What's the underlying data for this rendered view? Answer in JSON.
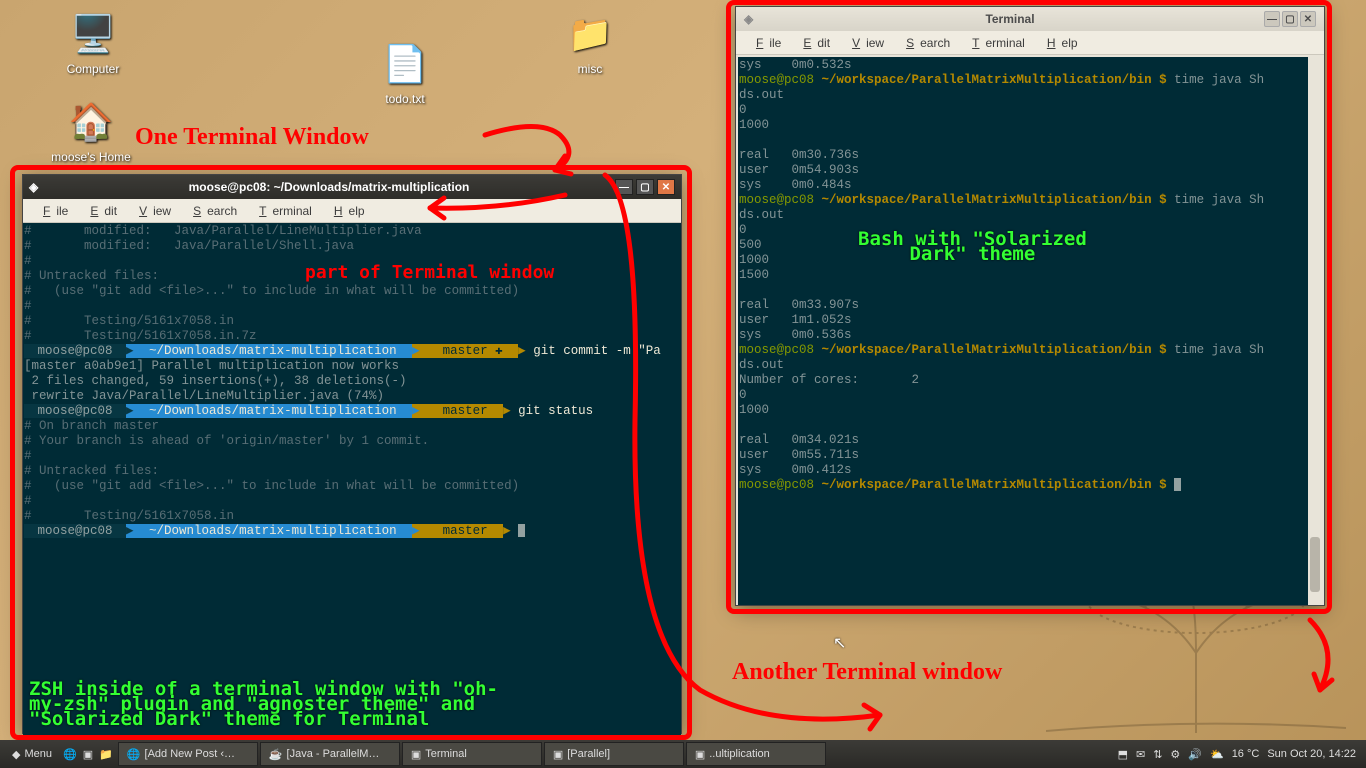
{
  "desktop": {
    "icons": [
      {
        "label": "Computer"
      },
      {
        "label": "todo.txt"
      },
      {
        "label": "misc"
      },
      {
        "label": "moose's Home"
      }
    ]
  },
  "window_left": {
    "title": "moose@pc08: ~/Downloads/matrix-multiplication",
    "menu": [
      "File",
      "Edit",
      "View",
      "Search",
      "Terminal",
      "Help"
    ],
    "lines": {
      "l1": "#       modified:   Java/Parallel/LineMultiplier.java",
      "l2": "#       modified:   Java/Parallel/Shell.java",
      "l3": "#",
      "l4": "# Untracked files:",
      "l5": "#   (use \"git add <file>...\" to include in what will be committed)",
      "l6": "#",
      "l7": "#       Testing/5161x7058.in",
      "l8": "#       Testing/5161x7058.in.7z",
      "p1_user": " moose@pc08 ",
      "p1_path": " ~/Downloads/matrix-multiplication ",
      "p1_git": "  master ✚ ",
      "p1_cmd": " git commit -m \"Pa",
      "l9": "[master a0ab9e1] Parallel multiplication now works",
      "l10": " 2 files changed, 59 insertions(+), 38 deletions(-)",
      "l11": " rewrite Java/Parallel/LineMultiplier.java (74%)",
      "p2_git": "  master ",
      "p2_cmd": " git status",
      "l12": "# On branch master",
      "l13": "# Your branch is ahead of 'origin/master' by 1 commit.",
      "l14": "#",
      "l15": "# Untracked files:",
      "l16": "#   (use \"git add <file>...\" to include in what will be committed)",
      "l17": "#",
      "l18": "#       Testing/5161x7058.in"
    }
  },
  "window_right": {
    "title": "Terminal",
    "menu": [
      "File",
      "Edit",
      "View",
      "Search",
      "Terminal",
      "Help"
    ],
    "lines": {
      "r1": "sys    0m0.532s",
      "r2a": "moose@pc08",
      "r2b": " ~/workspace/ParallelMatrixMultiplication/bin $",
      "r2c": " time java Sh",
      "r3": "ds.out",
      "r4": "0",
      "r5": "1000",
      "r7": "real   0m30.736s",
      "r8": "user   0m54.903s",
      "r9": "sys    0m0.484s",
      "r10c": " time java Sh",
      "r11": "ds.out",
      "r12": "0",
      "r13": "500",
      "r14": "1000",
      "r15": "1500",
      "r17": "real   0m33.907s",
      "r18": "user   1m1.052s",
      "r19": "sys    0m0.536s",
      "r20c": " time java Sh",
      "r21": "ds.out",
      "r22": "Number of cores:       2",
      "r23": "0",
      "r24": "1000",
      "r26": "real   0m34.021s",
      "r27": "user   0m55.711s",
      "r28": "sys    0m0.412s",
      "r29c": " "
    }
  },
  "annotations": {
    "one_window": "One Terminal Window",
    "part_of": "part of Terminal window",
    "zsh": "ZSH inside of a terminal window with \"oh-\nmy-zsh\" plugin and \"agnoster theme\" and\n\"Solarized Dark\" theme for Terminal",
    "another": "Another Terminal window",
    "bash": "Bash with \"Solarized\nDark\" theme"
  },
  "panel": {
    "menu": "Menu",
    "tasks": [
      "[Add New Post ‹…",
      "[Java - ParallelM…",
      "Terminal",
      "[Parallel]",
      "..ultiplication"
    ],
    "weather": "16 °C",
    "clock": "Sun Oct 20, 14:22"
  }
}
